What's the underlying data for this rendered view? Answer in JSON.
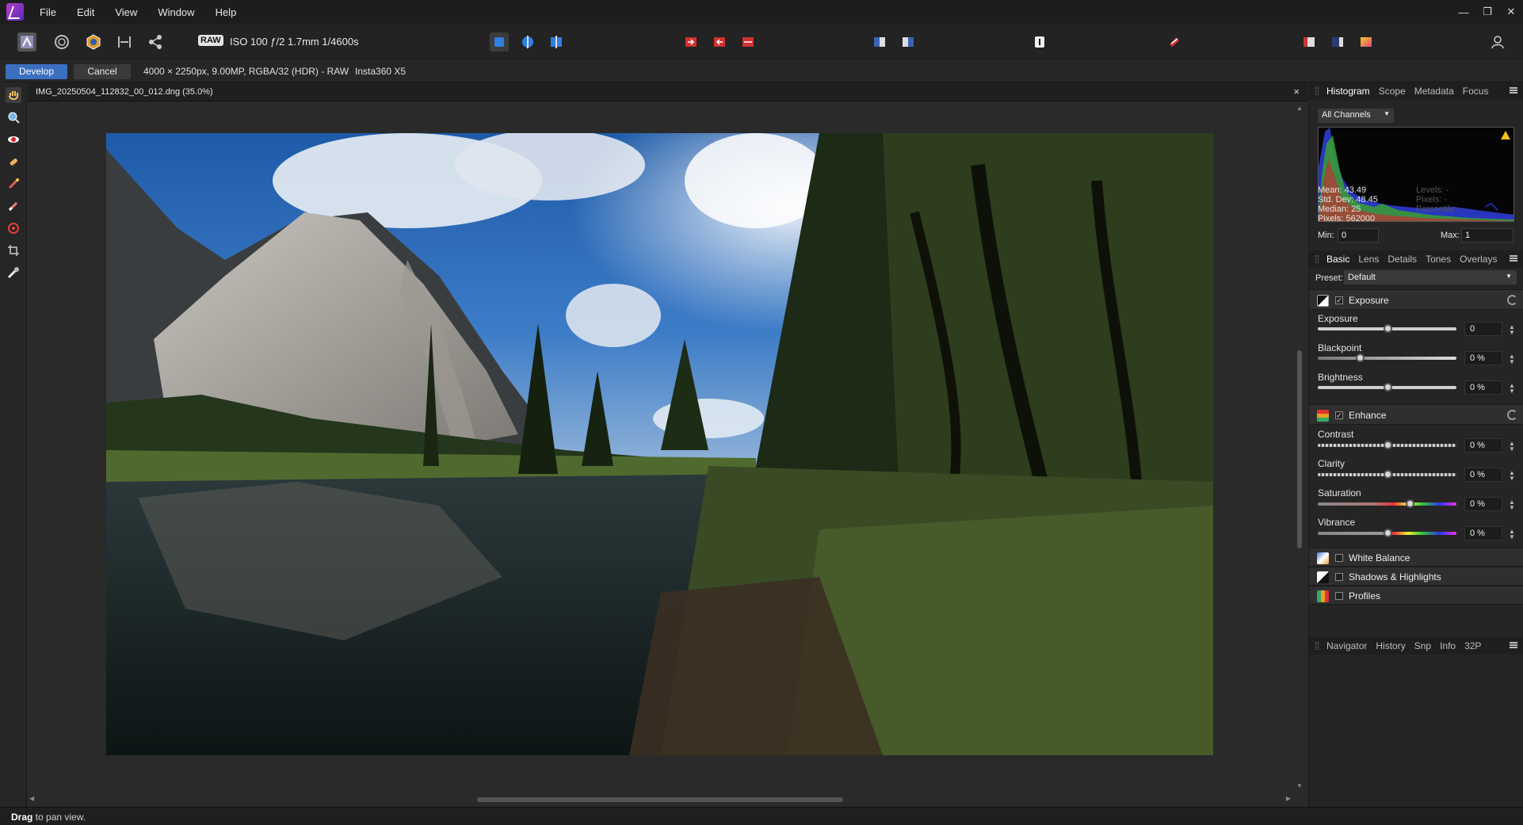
{
  "menubar": {
    "items": [
      "File",
      "Edit",
      "View",
      "Window",
      "Help"
    ],
    "window_controls": [
      "minimize-icon",
      "restore-icon",
      "close-icon"
    ]
  },
  "toolbar": {
    "raw_badge": "RAW",
    "exif": "ISO 100 ƒ/2 1.7mm 1/4600s"
  },
  "context": {
    "develop_label": "Develop",
    "cancel_label": "Cancel",
    "image_info": "4000 × 2250px, 9.00MP, RGBA/32 (HDR) - RAW",
    "camera": "Insta360 X5"
  },
  "document": {
    "title": "IMG_20250504_112832_00_012.dng (35.0%)",
    "close": "×"
  },
  "histogram_panel": {
    "tabs": [
      "Histogram",
      "Scope",
      "Metadata",
      "Focus"
    ],
    "channel": "All Channels",
    "stats": {
      "mean": "Mean: 43.49",
      "std": "Std. Dev: 48.45",
      "median": "Median: 25",
      "pixels": "Pixels: 562000"
    },
    "dim_stats": {
      "levels": "Levels: -",
      "pixels": "Pixels: -",
      "percentile": "Percentile: -"
    },
    "min_label": "Min:",
    "min_value": "0",
    "max_label": "Max:",
    "max_value": "1"
  },
  "develop_panel": {
    "tabs": [
      "Basic",
      "Lens",
      "Details",
      "Tones",
      "Overlays"
    ],
    "preset_label": "Preset:",
    "preset_value": "Default",
    "exposure_section": "Exposure",
    "enhance_section": "Enhance",
    "sliders": [
      {
        "label": "Exposure",
        "value": "0",
        "pos": 0.5
      },
      {
        "label": "Blackpoint",
        "value": "0 %",
        "pos": 0.3
      },
      {
        "label": "Brightness",
        "value": "0 %",
        "pos": 0.5
      },
      {
        "label": "Contrast",
        "value": "0 %",
        "pos": 0.5
      },
      {
        "label": "Clarity",
        "value": "0 %",
        "pos": 0.5
      },
      {
        "label": "Saturation",
        "value": "0 %",
        "pos": 0.66
      },
      {
        "label": "Vibrance",
        "value": "0 %",
        "pos": 0.5
      }
    ],
    "collapsed_sections": [
      "White Balance",
      "Shadows & Highlights",
      "Profiles"
    ]
  },
  "bottom_panel": {
    "tabs": [
      "Navigator",
      "History",
      "Snp",
      "Info",
      "32P"
    ]
  },
  "status": {
    "bold": "Drag",
    "rest": " to pan view."
  },
  "colors": {
    "accent": "#3b6fc0",
    "bg": "#2b2b2b"
  }
}
